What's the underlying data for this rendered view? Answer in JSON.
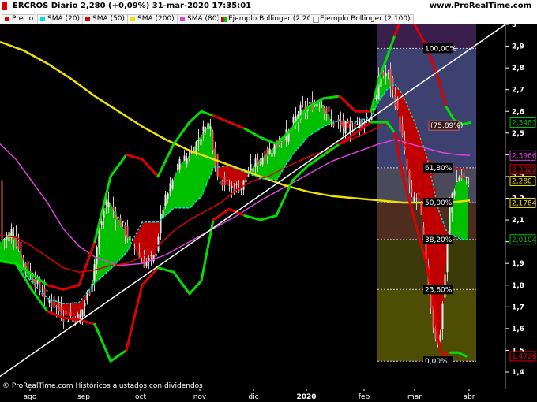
{
  "header": {
    "title": "ERCROS Diario 2,280 (+0,09%) 31-mar-2020 17:35:01",
    "site": "www.ProRealTime.com",
    "copyright": "© ProRealTime.com  Históricos ajustados con dividendos"
  },
  "legend": [
    {
      "label": "Precio",
      "color": "#e00000"
    },
    {
      "label": "SMA (20)",
      "color": "#00e0e0"
    },
    {
      "label": "SMA (50)",
      "color": "#e00000"
    },
    {
      "label": "SMA (200)",
      "color": "#f0e000"
    },
    {
      "label": "SMA (80)",
      "color": "#e040e0"
    },
    {
      "label": "Ejemplo Bollinger (2 20)",
      "color": "#e00000",
      "color2": "#00c000"
    },
    {
      "label": "Ejemplo Bollinger (2 100)",
      "color": "#ffffff"
    }
  ],
  "colors": {
    "background": "#000000",
    "sma200": "#f0e000",
    "sma80": "#e040e0",
    "sma50": "#e00000",
    "sma20": "#00e0e0",
    "band_up": "#00c000",
    "band_down": "#c00000",
    "trendline": "#ffffff"
  },
  "chart_data": {
    "type": "candlestick",
    "y_axis": {
      "range": [
        1.35,
        3.05
      ],
      "ticks": [
        "1,4",
        "1,5",
        "1,6",
        "1,7",
        "1,8",
        "1,9",
        "2",
        "2,1",
        "2,2",
        "2,3",
        "2,4",
        "2,5",
        "2,6",
        "2,7",
        "2,8",
        "2,9",
        "3"
      ]
    },
    "x_axis": {
      "labels": [
        "ago",
        "sep",
        "oct",
        "nov",
        "dic",
        "2020",
        "feb",
        "mar",
        "abr"
      ]
    },
    "price_labels": [
      {
        "text": "2,5483",
        "value": 2.5483,
        "color": "#00c000"
      },
      {
        "text": "2,3966",
        "value": 2.3966,
        "color": "#e040e0"
      },
      {
        "text": "2,3329",
        "value": 2.3329,
        "color": "#e00000"
      },
      {
        "text": "2,280",
        "value": 2.28,
        "color": "#f0e000"
      },
      {
        "text": "2,1784",
        "value": 2.1784,
        "color": "#f0e000"
      },
      {
        "text": "2,0104",
        "value": 2.0104,
        "color": "#00c000"
      },
      {
        "text": "1,4728",
        "value": 1.4728,
        "color": "#e00000"
      }
    ],
    "fibonacci": [
      {
        "level": "100,00%",
        "value": 2.89
      },
      {
        "level": "(75,89%)",
        "value": 2.535
      },
      {
        "level": "61,80%",
        "value": 2.34
      },
      {
        "level": "50,00%",
        "value": 2.18
      },
      {
        "level": "38,20%",
        "value": 2.01
      },
      {
        "level": "23,60%",
        "value": 1.78
      },
      {
        "level": "0,00%",
        "value": 1.45
      }
    ],
    "sma200": [
      [
        0,
        2.92
      ],
      [
        30,
        2.88
      ],
      [
        60,
        2.82
      ],
      [
        90,
        2.75
      ],
      [
        120,
        2.67
      ],
      [
        150,
        2.6
      ],
      [
        180,
        2.53
      ],
      [
        210,
        2.47
      ],
      [
        240,
        2.42
      ],
      [
        270,
        2.38
      ],
      [
        300,
        2.34
      ],
      [
        330,
        2.3
      ],
      [
        360,
        2.26
      ],
      [
        390,
        2.23
      ],
      [
        420,
        2.21
      ],
      [
        450,
        2.2
      ],
      [
        480,
        2.19
      ],
      [
        510,
        2.18
      ],
      [
        540,
        2.18
      ],
      [
        570,
        2.18
      ],
      [
        595,
        2.19
      ]
    ],
    "sma80": [
      [
        0,
        2.45
      ],
      [
        20,
        2.38
      ],
      [
        40,
        2.28
      ],
      [
        60,
        2.18
      ],
      [
        80,
        2.06
      ],
      [
        100,
        1.98
      ],
      [
        120,
        1.93
      ],
      [
        150,
        1.89
      ],
      [
        180,
        1.9
      ],
      [
        210,
        1.94
      ],
      [
        240,
        2.0
      ],
      [
        270,
        2.06
      ],
      [
        300,
        2.12
      ],
      [
        330,
        2.19
      ],
      [
        360,
        2.25
      ],
      [
        390,
        2.31
      ],
      [
        420,
        2.37
      ],
      [
        450,
        2.41
      ],
      [
        480,
        2.45
      ],
      [
        500,
        2.47
      ],
      [
        520,
        2.45
      ],
      [
        540,
        2.43
      ],
      [
        560,
        2.41
      ],
      [
        580,
        2.4
      ],
      [
        595,
        2.397
      ]
    ],
    "sma50": [
      [
        0,
        2.03
      ],
      [
        20,
        2.02
      ],
      [
        40,
        1.98
      ],
      [
        60,
        1.93
      ],
      [
        80,
        1.88
      ],
      [
        100,
        1.86
      ],
      [
        120,
        1.87
      ],
      [
        140,
        1.89
      ],
      [
        160,
        1.9
      ],
      [
        180,
        1.93
      ],
      [
        200,
        1.98
      ],
      [
        220,
        2.05
      ],
      [
        240,
        2.1
      ],
      [
        260,
        2.14
      ],
      [
        280,
        2.18
      ],
      [
        300,
        2.24
      ],
      [
        320,
        2.28
      ],
      [
        340,
        2.3
      ],
      [
        360,
        2.34
      ],
      [
        390,
        2.39
      ],
      [
        420,
        2.43
      ],
      [
        450,
        2.48
      ],
      [
        470,
        2.51
      ],
      [
        490,
        2.55
      ],
      [
        510,
        2.45
      ],
      [
        530,
        2.4
      ],
      [
        550,
        2.36
      ],
      [
        570,
        2.34
      ],
      [
        595,
        2.333
      ]
    ],
    "bb_upper": [
      [
        0,
        1.91
      ],
      [
        20,
        1.9
      ],
      [
        40,
        1.85
      ],
      [
        60,
        1.8
      ],
      [
        80,
        1.78
      ],
      [
        100,
        1.8
      ],
      [
        120,
        2.0
      ],
      [
        140,
        2.3
      ],
      [
        160,
        2.4
      ],
      [
        180,
        2.38
      ],
      [
        200,
        2.3
      ],
      [
        220,
        2.45
      ],
      [
        240,
        2.55
      ],
      [
        255,
        2.6
      ],
      [
        270,
        2.58
      ],
      [
        290,
        2.55
      ],
      [
        310,
        2.52
      ],
      [
        330,
        2.48
      ],
      [
        350,
        2.45
      ],
      [
        370,
        2.52
      ],
      [
        390,
        2.62
      ],
      [
        410,
        2.66
      ],
      [
        430,
        2.67
      ],
      [
        450,
        2.6
      ],
      [
        470,
        2.6
      ],
      [
        480,
        2.75
      ],
      [
        490,
        2.85
      ],
      [
        500,
        2.95
      ],
      [
        510,
        3.05
      ],
      [
        525,
        3.0
      ],
      [
        540,
        2.9
      ],
      [
        555,
        2.75
      ],
      [
        565,
        2.62
      ],
      [
        575,
        2.56
      ],
      [
        585,
        2.54
      ],
      [
        595,
        2.548
      ]
    ],
    "bb_lower": [
      [
        0,
        1.91
      ],
      [
        20,
        1.9
      ],
      [
        40,
        1.78
      ],
      [
        60,
        1.68
      ],
      [
        80,
        1.65
      ],
      [
        100,
        1.64
      ],
      [
        120,
        1.62
      ],
      [
        140,
        1.45
      ],
      [
        160,
        1.5
      ],
      [
        180,
        1.8
      ],
      [
        200,
        1.88
      ],
      [
        220,
        1.86
      ],
      [
        240,
        1.76
      ],
      [
        255,
        1.82
      ],
      [
        270,
        2.1
      ],
      [
        290,
        2.15
      ],
      [
        310,
        2.12
      ],
      [
        330,
        2.1
      ],
      [
        350,
        2.12
      ],
      [
        370,
        2.28
      ],
      [
        390,
        2.35
      ],
      [
        410,
        2.4
      ],
      [
        430,
        2.45
      ],
      [
        450,
        2.5
      ],
      [
        470,
        2.55
      ],
      [
        480,
        2.55
      ],
      [
        490,
        2.55
      ],
      [
        500,
        2.5
      ],
      [
        510,
        2.3
      ],
      [
        525,
        2.1
      ],
      [
        540,
        1.9
      ],
      [
        548,
        1.75
      ],
      [
        555,
        1.55
      ],
      [
        560,
        1.48
      ],
      [
        570,
        1.49
      ],
      [
        580,
        1.49
      ],
      [
        590,
        1.473
      ]
    ],
    "trendline": [
      [
        0,
        1.38
      ],
      [
        640,
        3.0
      ]
    ],
    "candles_summary": "daily OHLC bars, descending from 2,0 in Aug to 1,63 in Sep, rally to 2,6 in Oct/Nov, 2,8 in Jan-Feb, crash to 1,5 in mid-March and rebound to 2,28"
  }
}
